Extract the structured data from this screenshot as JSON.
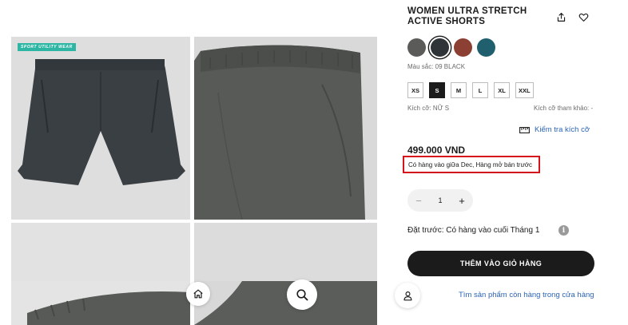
{
  "product": {
    "title": "WOMEN ULTRA STRETCH ACTIVE SHORTS",
    "badge": "SPORT UTILITY WEAR",
    "color_label": "Màu sắc: 09 BLACK",
    "colors": [
      {
        "name": "gray",
        "hex": "#5b5c5a"
      },
      {
        "name": "black",
        "hex": "#2f3439",
        "selected": true
      },
      {
        "name": "brown",
        "hex": "#8c4034"
      },
      {
        "name": "teal",
        "hex": "#1f5f6e"
      }
    ],
    "sizes": [
      "XS",
      "S",
      "M",
      "L",
      "XL",
      "XXL"
    ],
    "selected_size": "S",
    "size_label": "Kích cỡ: NỮ S",
    "size_reference_label": "Kích cỡ tham khảo: -",
    "size_check_link": "Kiểm tra kích cỡ",
    "price": "499.000 VND",
    "stock_note": "Có hàng vào giữa Dec, Hàng mở bán trước",
    "quantity": "1",
    "preorder_text": "Đặt trước: Có hàng vào cuối Tháng 1",
    "add_to_cart": "THÊM VÀO GIỎ HÀNG",
    "store_link": "Tìm sản phẩm còn hàng trong cửa hàng"
  },
  "icons": {
    "share": "share-icon",
    "favorite": "heart-icon",
    "ruler": "ruler-icon",
    "info": "info-icon",
    "home": "home-icon",
    "search": "search-icon",
    "store": "person-icon"
  },
  "colors": {
    "highlight_border": "#d6131a",
    "link": "#2b64b6",
    "primary_button": "#1b1b1b",
    "badge": "#2cb6a3"
  }
}
